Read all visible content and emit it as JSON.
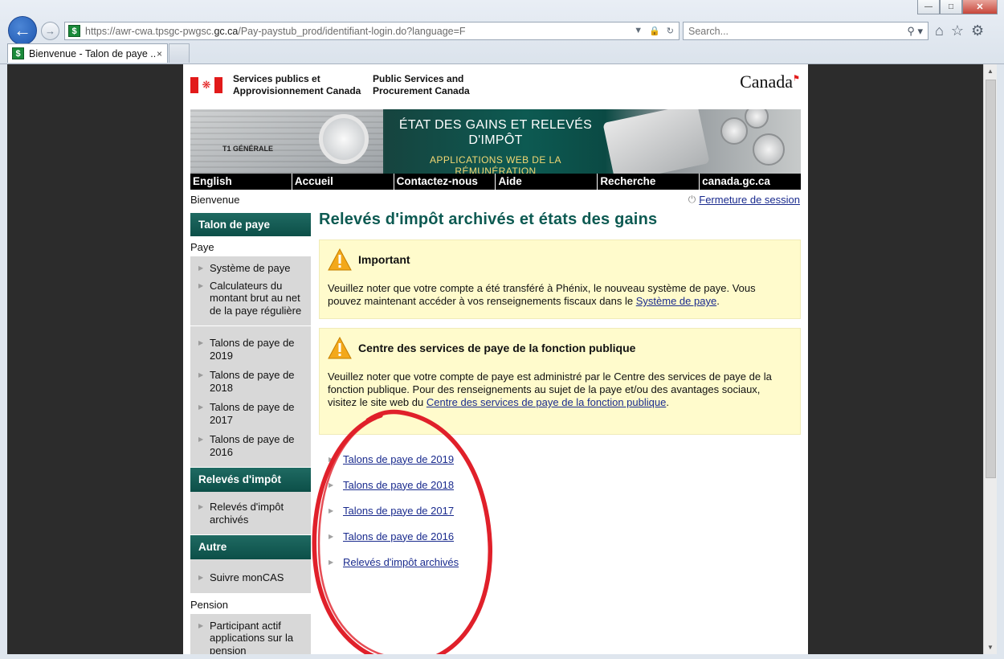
{
  "browser": {
    "url_prefix": "https://awr-cwa.tpsgc-pwgsc.",
    "url_domain": "gc.ca",
    "url_suffix": "/Pay-paystub_prod/identifiant-login.do?language=F",
    "search_placeholder": "Search...",
    "tab_title": "Bienvenue - Talon de paye ...",
    "tab_close": "×"
  },
  "header": {
    "dept_fr_line1": "Services publics et",
    "dept_fr_line2": "Approvisionnement Canada",
    "dept_en_line1": "Public Services and",
    "dept_en_line2": "Procurement Canada",
    "wordmark": "Canada"
  },
  "banner": {
    "title_line1": "ÉTAT DES GAINS ET RELEVÉS",
    "title_line2": "D'IMPÔT",
    "subtitle": "APPLICATIONS WEB DE LA RÉMUNÉRATION",
    "paper_text": "T1 GÉNÉRALE"
  },
  "topnav": [
    "English",
    "Accueil",
    "Contactez-nous",
    "Aide",
    "Recherche",
    "canada.gc.ca"
  ],
  "welcome": "Bienvenue",
  "logout": "Fermeture de session",
  "leftnav": {
    "section1": "Talon de paye",
    "paye_label": "Paye",
    "paye_items": [
      "Système de paye",
      "Calculateurs du montant brut au net de la paye régulière"
    ],
    "talons_items": [
      "Talons de paye de 2019",
      "Talons de paye de 2018",
      "Talons de paye de 2017",
      "Talons de paye de 2016"
    ],
    "section2": "Relevés d'impôt",
    "releves_items": [
      "Relevés d'impôt archivés"
    ],
    "section3": "Autre",
    "autre_items": [
      "Suivre monCAS"
    ],
    "pension_label": "Pension",
    "pension_items": [
      "Participant actif applications sur la pension"
    ]
  },
  "main": {
    "title": "Relevés d'impôt archivés et états des gains",
    "alert1": {
      "title": "Important",
      "body_before": "Veuillez noter que votre compte a été transféré à Phénix, le nouveau système de paye. Vous pouvez maintenant accéder à vos renseignements fiscaux dans le ",
      "link": "Système de paye",
      "body_after": "."
    },
    "alert2": {
      "title": "Centre des services de paye de la fonction publique",
      "body_before": "Veuillez noter que votre compte de paye est administré par le Centre des services de paye de la fonction publique. Pour des renseignements au sujet de la paye et/ou des avantages sociaux, visitez le site web du ",
      "link": "Centre des services de paye de la fonction publique",
      "body_after": "."
    },
    "links": [
      "Talons de paye de 2019",
      "Talons de paye de 2018",
      "Talons de paye de 2017",
      "Talons de paye de 2016",
      "Relevés d'impôt archivés"
    ]
  },
  "colors": {
    "accent_teal": "#0d5a52",
    "alert_bg": "#fffbcc",
    "link": "#1a2b8e",
    "annotation_red": "#e0202a"
  }
}
